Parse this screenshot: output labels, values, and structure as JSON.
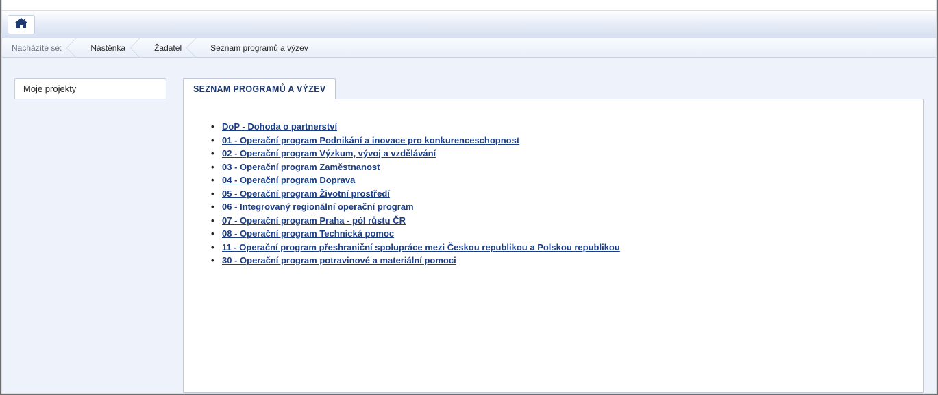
{
  "topbar": {
    "home_title": "Domů"
  },
  "breadcrumb": {
    "label": "Nacházíte se:",
    "items": [
      "Nástěnka",
      "Žadatel",
      "Seznam programů a výzev"
    ]
  },
  "sidebar": {
    "items": [
      {
        "label": "Moje projekty"
      }
    ]
  },
  "main": {
    "tab_title": "SEZNAM PROGRAMŮ A VÝZEV",
    "programs": [
      "DoP - Dohoda o partnerství",
      "01 - Operační program Podnikání a inovace pro konkurenceschopnost",
      "02 - Operační program Výzkum, vývoj a vzdělávání",
      "03 - Operační program Zaměstnanost",
      "04 - Operační program Doprava",
      "05 - Operační program Životní prostředí",
      "06 - Integrovaný regionální operační program",
      "07 - Operační program Praha - pól růstu ČR",
      "08 - Operační program Technická pomoc",
      "11 - Operační program přeshraniční spolupráce mezi Českou republikou a Polskou republikou",
      "30 - Operační program potravinové a materiální pomoci"
    ]
  }
}
